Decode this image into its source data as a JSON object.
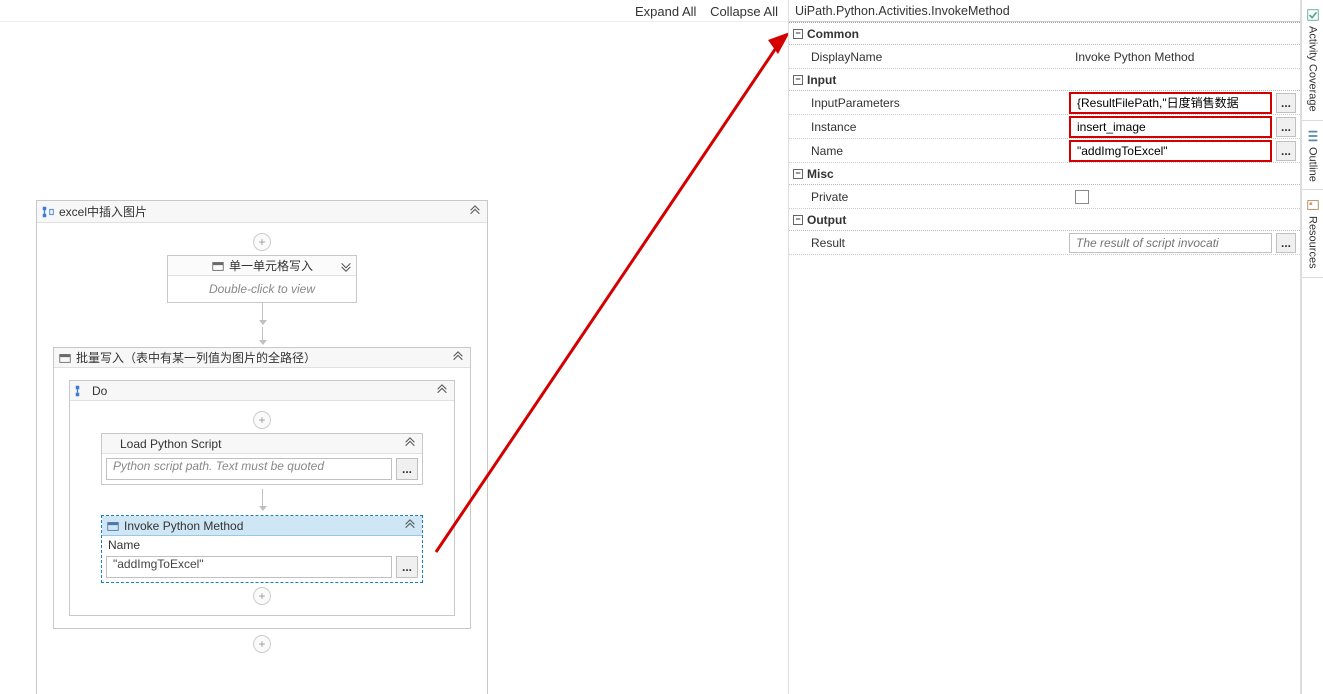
{
  "header": {
    "expand_all": "Expand All",
    "collapse_all": "Collapse All"
  },
  "workflow": {
    "outer_title": "excel中插入图片",
    "collapsed_act": {
      "title": "单一单元格写入",
      "hint": "Double-click to view"
    },
    "batch_title": "批量写入（表中有某一列值为图片的全路径）",
    "do_title": "Do",
    "load_script": {
      "title": "Load Python Script",
      "placeholder": "Python script path. Text must be quoted"
    },
    "invoke_python": {
      "title": "Invoke Python Method",
      "name_label": "Name",
      "name_value": "\"addImgToExcel\""
    }
  },
  "properties": {
    "title": "UiPath.Python.Activities.InvokeMethod",
    "cat_common": "Common",
    "display_name_label": "DisplayName",
    "display_name_value": "Invoke Python Method",
    "cat_input": "Input",
    "input_params_label": "InputParameters",
    "input_params_value": "{ResultFilePath,\"日度销售数据",
    "instance_label": "Instance",
    "instance_value": "insert_image",
    "name_label": "Name",
    "name_value": "\"addImgToExcel\"",
    "cat_misc": "Misc",
    "private_label": "Private",
    "cat_output": "Output",
    "result_label": "Result",
    "result_placeholder": "The result of script invocati"
  },
  "side_tabs": {
    "activity_coverage": "Activity Coverage",
    "outline": "Outline",
    "resources": "Resources"
  },
  "icons": {
    "ellipsis": "..."
  }
}
